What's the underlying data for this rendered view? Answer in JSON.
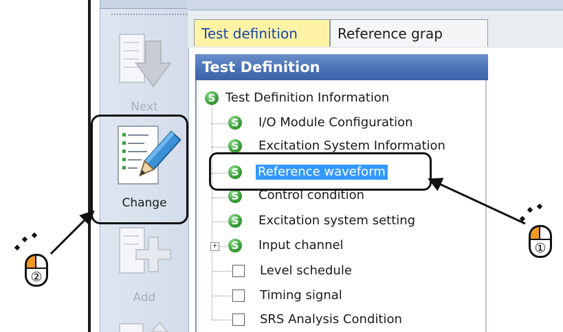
{
  "toolbar": {
    "next_label": "Next",
    "change_label": "Change",
    "add_label": "Add"
  },
  "tabs": [
    {
      "label": "Test definition",
      "active": true
    },
    {
      "label": "Reference grap",
      "active": false
    }
  ],
  "panel": {
    "title": "Test Definition"
  },
  "tree": {
    "root": {
      "label": "Test Definition Information",
      "icon": "s-green-icon"
    },
    "items": [
      {
        "label": "I/O Module Configuration",
        "icon": "s-green-icon"
      },
      {
        "label": "Excitation System Information",
        "icon": "s-green-icon"
      },
      {
        "label": "Reference waveform",
        "icon": "s-green-icon",
        "selected": true
      },
      {
        "label": "Control condition",
        "icon": "s-green-icon"
      },
      {
        "label": "Excitation system setting",
        "icon": "s-green-icon"
      },
      {
        "label": "Input channel",
        "icon": "s-green-icon",
        "expandable": true
      },
      {
        "label": "Level schedule",
        "icon": "checkbox"
      },
      {
        "label": "Timing signal",
        "icon": "checkbox"
      },
      {
        "label": "SRS Analysis Condition",
        "icon": "checkbox"
      }
    ],
    "s_glyph": "S",
    "expand_glyph": "+"
  },
  "callouts": {
    "step1": "①",
    "step2": "②",
    "accent_color": "#f39a1f"
  },
  "colors": {
    "active_tab_bg": "#fff3a6",
    "active_tab_text": "#1846a8",
    "header_bg": "#4a72b8",
    "selection_bg": "#3399ff"
  }
}
